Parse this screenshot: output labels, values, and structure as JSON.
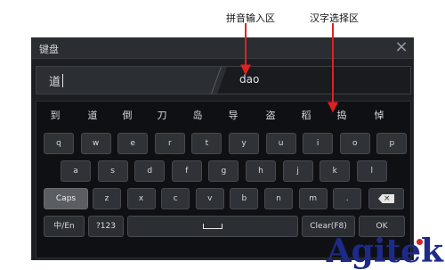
{
  "annotations": {
    "pinyin_area": "拼音输入区",
    "hanzi_area": "汉字选择区"
  },
  "window": {
    "title": "键盘",
    "close_icon": "close-icon"
  },
  "input": {
    "hanzi_value": "道",
    "pinyin_value": "dao"
  },
  "candidates": [
    "到",
    "道",
    "倒",
    "刀",
    "岛",
    "导",
    "盗",
    "稻",
    "捣",
    "悼"
  ],
  "keys": {
    "row1": [
      "q",
      "w",
      "e",
      "r",
      "t",
      "y",
      "u",
      "i",
      "o",
      "p"
    ],
    "row2": [
      "a",
      "s",
      "d",
      "f",
      "g",
      "h",
      "j",
      "k",
      "l"
    ],
    "row3_left": "Caps",
    "row3": [
      "z",
      "x",
      "c",
      "v",
      "b",
      "n",
      "m",
      "."
    ],
    "row3_right_icon": "backspace-icon",
    "row4": {
      "lang": "中/En",
      "symbols": "?123",
      "space_icon": "space-icon",
      "clear": "Clear(F8)",
      "ok": "OK"
    }
  },
  "watermark": "Agitek",
  "colors": {
    "window_bg": "#1c1e22",
    "key_bg": "#2f3237",
    "caps_bg": "#5a5d62",
    "arrow": "#e02020",
    "watermark": "#1d2a8a"
  }
}
